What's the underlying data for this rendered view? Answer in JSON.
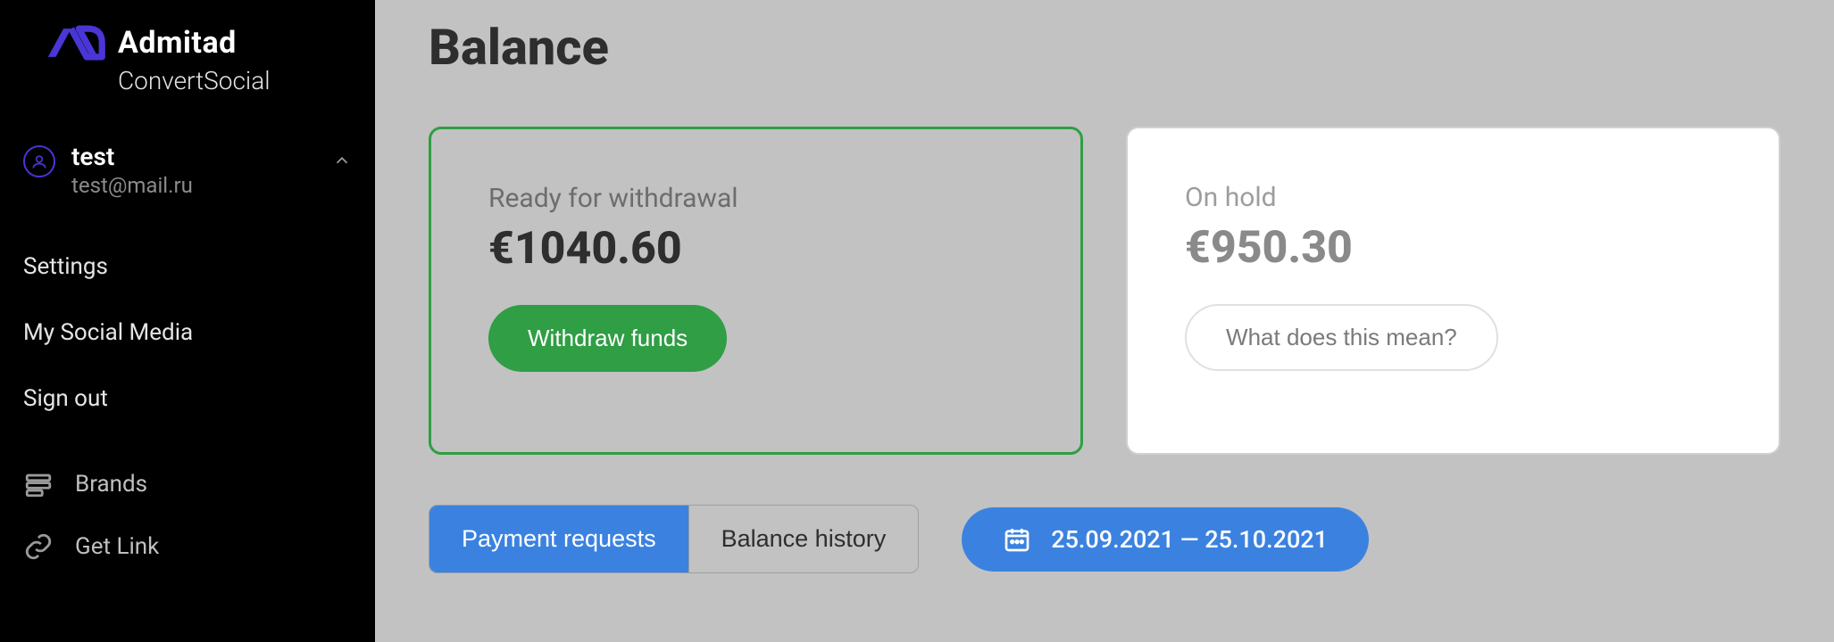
{
  "brand": {
    "name": "Admitad",
    "sub": "ConvertSocial"
  },
  "user": {
    "name": "test",
    "email": "test@mail.ru"
  },
  "sidebar": {
    "links": [
      "Settings",
      "My Social Media",
      "Sign out"
    ],
    "nav": [
      {
        "icon": "brands-icon",
        "label": "Brands"
      },
      {
        "icon": "link-icon",
        "label": "Get Link"
      }
    ]
  },
  "page": {
    "title": "Balance"
  },
  "balance": {
    "ready": {
      "label": "Ready for withdrawal",
      "amount": "€1040.60",
      "button": "Withdraw funds"
    },
    "onhold": {
      "label": "On hold",
      "amount": "€950.30",
      "button": "What does this mean?"
    }
  },
  "tabs": {
    "payment_requests": "Payment requests",
    "balance_history": "Balance history"
  },
  "date_range": "25.09.2021 — 25.10.2021"
}
